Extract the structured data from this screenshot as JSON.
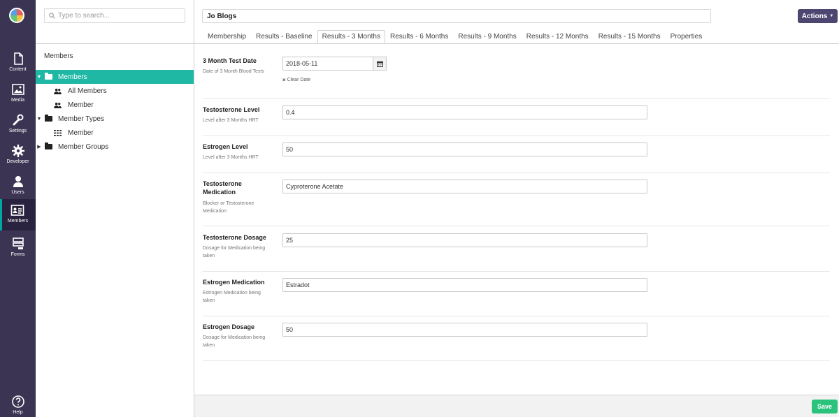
{
  "rail": {
    "items": [
      {
        "label": "Content",
        "icon": "document-icon"
      },
      {
        "label": "Media",
        "icon": "image-icon"
      },
      {
        "label": "Settings",
        "icon": "wrench-icon"
      },
      {
        "label": "Developer",
        "icon": "gear-icon"
      },
      {
        "label": "Users",
        "icon": "user-icon"
      },
      {
        "label": "Members",
        "icon": "id-card-icon"
      },
      {
        "label": "Forms",
        "icon": "form-icon"
      }
    ],
    "help_label": "Help"
  },
  "tree": {
    "search_placeholder": "Type to search...",
    "title": "Members",
    "nodes": [
      {
        "label": "Members"
      },
      {
        "label": "All Members"
      },
      {
        "label": "Member"
      },
      {
        "label": "Member Types"
      },
      {
        "label": "Member"
      },
      {
        "label": "Member Groups"
      }
    ]
  },
  "header": {
    "name": "Jo Blogs",
    "actions_label": "Actions",
    "tabs": [
      {
        "label": "Membership"
      },
      {
        "label": "Results - Baseline"
      },
      {
        "label": "Results - 3 Months"
      },
      {
        "label": "Results - 6 Months"
      },
      {
        "label": "Results - 9 Months"
      },
      {
        "label": "Results - 12 Months"
      },
      {
        "label": "Results - 15 Months"
      },
      {
        "label": "Properties"
      }
    ]
  },
  "props": {
    "test_date": {
      "label": "3 Month Test Date",
      "desc": "Date of 3 Month Blood Tests",
      "value": "2018-05-11",
      "clear_label": "Clear Date"
    },
    "testosterone_level": {
      "label": "Testosterone Level",
      "desc": "Level after 3 Months HRT",
      "value": "0.4"
    },
    "estrogen_level": {
      "label": "Estrogen Level",
      "desc": "Level after 3 Months HRT",
      "value": "50"
    },
    "testosterone_medication": {
      "label": "Testosterone Medication",
      "desc": "Blocker or Testosterone Medication",
      "value": "Cyproterone Acetate"
    },
    "testosterone_dosage": {
      "label": "Testosterone Dosage",
      "desc": "Dosage for Medication being taken",
      "value": "25"
    },
    "estrogen_medication": {
      "label": "Estrogen Medication",
      "desc": "Estrogen Medication being taken",
      "value": "Estradot"
    },
    "estrogen_dosage": {
      "label": "Estrogen Dosage",
      "desc": "Dosage for Medication being taken",
      "value": "50"
    }
  },
  "footer": {
    "save_label": "Save"
  }
}
